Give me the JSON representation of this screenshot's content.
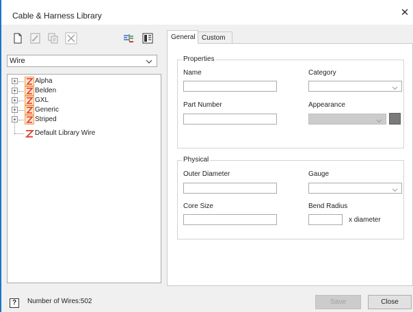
{
  "window": {
    "title": "Cable & Harness Library",
    "close_glyph": "✕"
  },
  "toolbar": {
    "buttons": [
      {
        "icon": "new-document-icon"
      },
      {
        "icon": "edit-icon"
      },
      {
        "icon": "copy-icon"
      },
      {
        "icon": "delete-icon"
      },
      {
        "icon": "filter-icon"
      },
      {
        "icon": "library-view-icon"
      }
    ]
  },
  "library_type": {
    "selected": "Wire"
  },
  "tree": {
    "items": [
      {
        "label": "Alpha",
        "expandable": true
      },
      {
        "label": "Belden",
        "expandable": true
      },
      {
        "label": "GXL",
        "expandable": true
      },
      {
        "label": "Generic",
        "expandable": true
      },
      {
        "label": "Striped",
        "expandable": true
      },
      {
        "label": "Default Library Wire",
        "expandable": false
      }
    ],
    "expander_glyph": "+"
  },
  "status": {
    "help_glyph": "?",
    "text": "Number of Wires:502"
  },
  "tabs": [
    {
      "label": "General",
      "active": true
    },
    {
      "label": "Custom",
      "active": false
    }
  ],
  "properties": {
    "group_title": "Properties",
    "name_label": "Name",
    "name_value": "",
    "category_label": "Category",
    "category_value": "",
    "part_number_label": "Part Number",
    "part_number_value": "",
    "appearance_label": "Appearance",
    "appearance_value": "",
    "appearance_color": "#7a7a7a"
  },
  "physical": {
    "group_title": "Physical",
    "outer_diameter_label": "Outer Diameter",
    "outer_diameter_value": "",
    "gauge_label": "Gauge",
    "gauge_value": "",
    "core_size_label": "Core Size",
    "core_size_value": "",
    "bend_radius_label": "Bend Radius",
    "bend_radius_value": "",
    "bend_radius_unit": "x diameter"
  },
  "buttons": {
    "save": "Save",
    "close": "Close"
  },
  "colors": {
    "window_border": "#1b74c8",
    "wire_icon": "#e8382a",
    "wire_icon_bg": "#f4a259"
  }
}
